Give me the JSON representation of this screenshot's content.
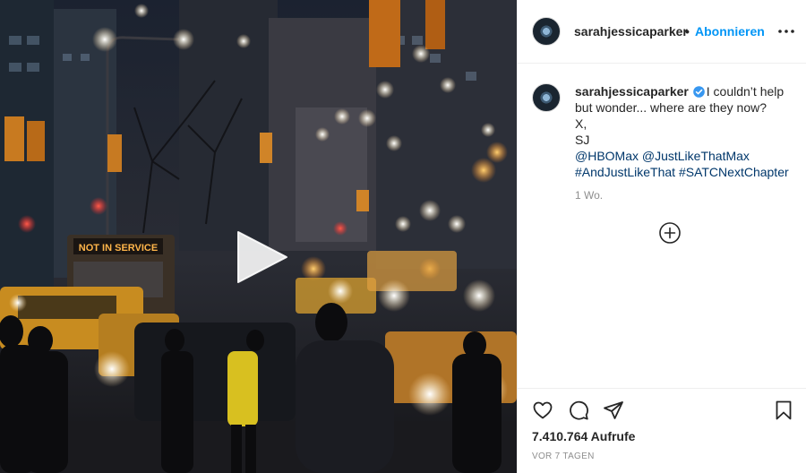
{
  "post": {
    "username": "sarahjessicaparker",
    "separator": "•",
    "follow_label": "Abonnieren",
    "caption_lines": [
      "I couldn’t help",
      "but wonder... where are they now?",
      "X,",
      "SJ"
    ],
    "caption_tags_line1": "@HBOMax @JustLikeThatMax",
    "caption_tags_line2": "#AndJustLikeThat #SATCNextChapter",
    "time_ago": "1 Wo.",
    "views": "7.410.764 Aufrufe",
    "date": "VOR 7 TAGEN"
  },
  "video": {
    "bus_sign_text": "NOT IN SERVICE"
  },
  "colors": {
    "follow_blue": "#0095f6",
    "hashtag_blue": "#00376b",
    "verified_blue": "#3897f0",
    "muted_gray": "#8e8e8e",
    "text": "#262626"
  },
  "icons": {
    "play": "play-icon",
    "more": "more-options-icon",
    "verified": "verified-badge-icon",
    "load_more": "plus-circle-icon",
    "like": "heart-icon",
    "comment": "comment-icon",
    "share": "paper-plane-icon",
    "save": "bookmark-icon"
  }
}
